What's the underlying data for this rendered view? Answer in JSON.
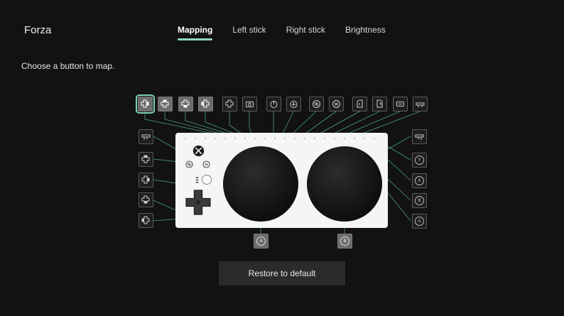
{
  "app": {
    "title": "Forza"
  },
  "tabs": [
    {
      "label": "Mapping",
      "active": true
    },
    {
      "label": "Left stick",
      "active": false
    },
    {
      "label": "Right stick",
      "active": false
    },
    {
      "label": "Brightness",
      "active": false
    }
  ],
  "instruction": "Choose a button to map.",
  "top_buttons": [
    {
      "icon": "dpad-right-icon"
    },
    {
      "icon": "dpad-up-icon"
    },
    {
      "icon": "dpad-down-icon"
    },
    {
      "icon": "dpad-left-icon"
    },
    {
      "icon": "dpad-icon"
    },
    {
      "icon": "screenshot-icon"
    },
    {
      "icon": "left-stick-click-icon"
    },
    {
      "icon": "right-stick-click-icon"
    },
    {
      "icon": "view-button-icon"
    },
    {
      "icon": "menu-button-icon"
    },
    {
      "icon": "left-trigger-icon"
    },
    {
      "icon": "right-trigger-icon"
    },
    {
      "icon": "share-icon"
    },
    {
      "icon": "bumper-icon"
    }
  ],
  "left_buttons": [
    {
      "icon": "left-bumper-icon"
    },
    {
      "icon": "dpad-up-icon"
    },
    {
      "icon": "dpad-right-icon"
    },
    {
      "icon": "dpad-down-icon"
    },
    {
      "icon": "dpad-left-icon"
    }
  ],
  "right_buttons": [
    {
      "icon": "right-bumper-icon"
    },
    {
      "label": "Y"
    },
    {
      "label": "X"
    },
    {
      "label": "B"
    },
    {
      "label": "A"
    }
  ],
  "bottom_buttons": [
    {
      "label": "A"
    },
    {
      "label": "B"
    }
  ],
  "restore_label": "Restore to default"
}
